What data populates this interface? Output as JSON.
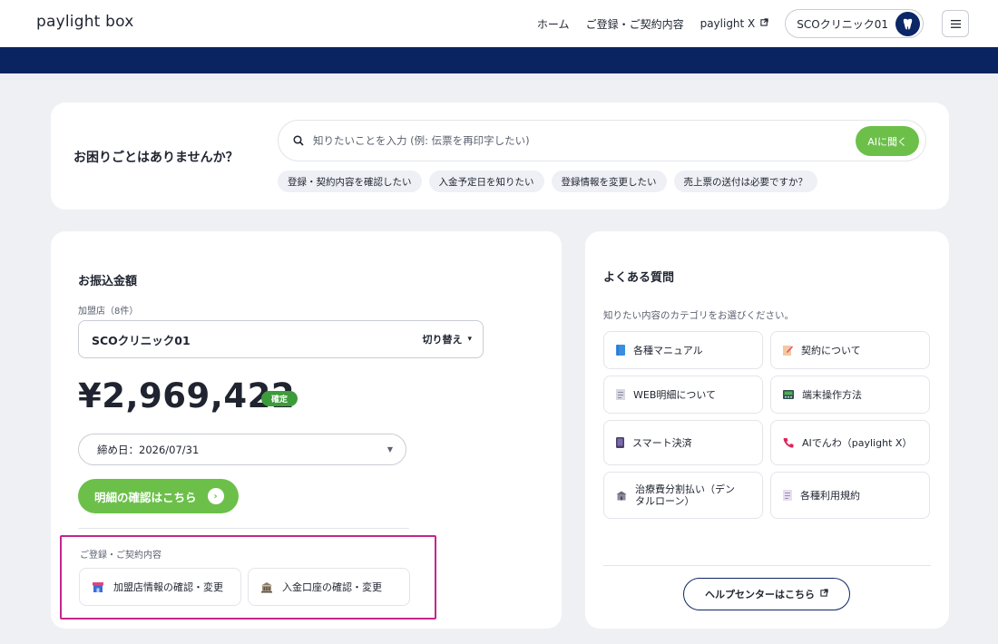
{
  "header": {
    "logo": "paylight box",
    "nav": {
      "home": "ホーム",
      "registration": "ご登録・ご契約内容",
      "paylight_x": "paylight X"
    },
    "account": "SCOクリニック01",
    "menu_icon": "hamburger-icon"
  },
  "search": {
    "heading": "お困りごとはありませんか？",
    "placeholder": "知りたいことを入力 (例: 伝票を再印字したい)",
    "ai_button": "AIに聞く",
    "chips": [
      "登録・契約内容を確認したい",
      "入金予定日を知りたい",
      "登録情報を変更したい",
      "売上票の送付は必要ですか？"
    ]
  },
  "transfer": {
    "title": "お振込金額",
    "store_label": "加盟店（8件）",
    "store_name": "SCOクリニック01",
    "switch_label": "切り替え",
    "amount": "¥2,969,422",
    "status": "確定",
    "closing_date": "締め日：2026/07/31",
    "detail_button": "明細の確認はこちら",
    "registration": {
      "label": "ご登録・ご契約内容",
      "store_info_button": "加盟店情報の確認・変更",
      "bank_account_button": "入金口座の確認・変更"
    }
  },
  "faq": {
    "title": "よくある質問",
    "description": "知りたい内容のカテゴリをお選びください。",
    "items": [
      {
        "label": "各種マニュアル",
        "icon": "book-icon"
      },
      {
        "label": "契約について",
        "icon": "contract-icon"
      },
      {
        "label": "WEB明細について",
        "icon": "document-icon"
      },
      {
        "label": "端末操作方法",
        "icon": "terminal-icon"
      },
      {
        "label": "スマート決済",
        "icon": "smartphone-icon"
      },
      {
        "label": "AIでんわ（paylight X）",
        "icon": "phone-icon"
      },
      {
        "label": "治療費分割払い（デンタルローン）",
        "icon": "clinic-icon"
      },
      {
        "label": "各種利用規約",
        "icon": "terms-icon"
      }
    ],
    "help_button": "ヘルプセンターはこちら"
  },
  "colors": {
    "brand_navy": "#0a2461",
    "accent_green": "#6cc04a",
    "confirmed_green": "#3e9b3b",
    "highlight_magenta": "#c6258e"
  }
}
